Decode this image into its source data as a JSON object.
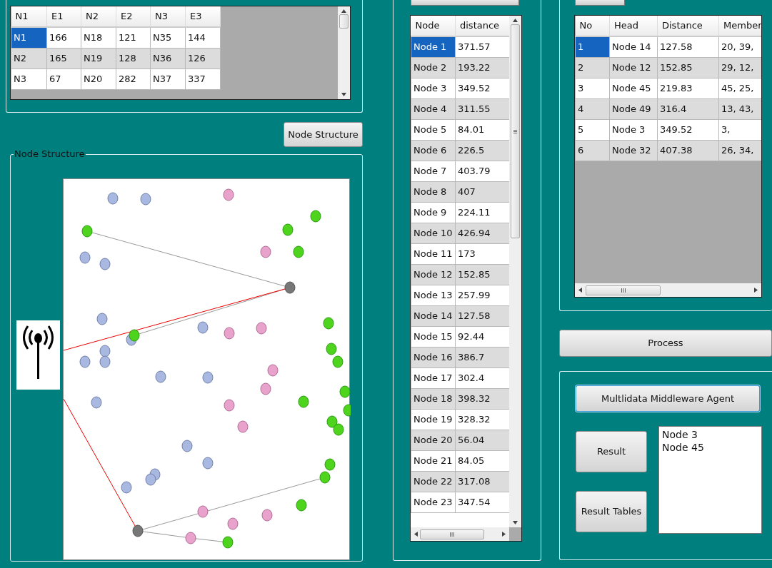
{
  "node_table": {
    "columns": [
      "N1",
      "E1",
      "N2",
      "E2",
      "N3",
      "E3"
    ],
    "rows": [
      {
        "cells": [
          "N1",
          "166",
          "N18",
          "121",
          "N35",
          "144"
        ],
        "selected": true
      },
      {
        "cells": [
          "N2",
          "165",
          "N19",
          "128",
          "N36",
          "126"
        ],
        "selected": false
      },
      {
        "cells": [
          "N3",
          "67",
          "N20",
          "282",
          "N37",
          "337"
        ],
        "selected": false
      }
    ]
  },
  "node_structure_button": "Node Structure",
  "node_structure_group": {
    "title": "Node Structure"
  },
  "distance_table": {
    "columns": [
      "Node",
      "distance"
    ],
    "rows": [
      {
        "cells": [
          "Node 1",
          "371.57"
        ],
        "selected": true
      },
      {
        "cells": [
          "Node 2",
          "193.22"
        ],
        "selected": false
      },
      {
        "cells": [
          "Node 3",
          "349.52"
        ],
        "selected": false
      },
      {
        "cells": [
          "Node 4",
          "311.55"
        ],
        "selected": false
      },
      {
        "cells": [
          "Node 5",
          "84.01"
        ],
        "selected": false
      },
      {
        "cells": [
          "Node 6",
          "226.5"
        ],
        "selected": false
      },
      {
        "cells": [
          "Node 7",
          "403.79"
        ],
        "selected": false
      },
      {
        "cells": [
          "Node 8",
          "407"
        ],
        "selected": false
      },
      {
        "cells": [
          "Node 9",
          "224.11"
        ],
        "selected": false
      },
      {
        "cells": [
          "Node 10",
          "426.94"
        ],
        "selected": false
      },
      {
        "cells": [
          "Node 11",
          "173"
        ],
        "selected": false
      },
      {
        "cells": [
          "Node 12",
          "152.85"
        ],
        "selected": false
      },
      {
        "cells": [
          "Node 13",
          "257.99"
        ],
        "selected": false
      },
      {
        "cells": [
          "Node 14",
          "127.58"
        ],
        "selected": false
      },
      {
        "cells": [
          "Node 15",
          "92.44"
        ],
        "selected": false
      },
      {
        "cells": [
          "Node 16",
          "386.7"
        ],
        "selected": false
      },
      {
        "cells": [
          "Node 17",
          "302.4"
        ],
        "selected": false
      },
      {
        "cells": [
          "Node 18",
          "398.32"
        ],
        "selected": false
      },
      {
        "cells": [
          "Node 19",
          "328.32"
        ],
        "selected": false
      },
      {
        "cells": [
          "Node 20",
          "56.04"
        ],
        "selected": false
      },
      {
        "cells": [
          "Node 21",
          "84.05"
        ],
        "selected": false
      },
      {
        "cells": [
          "Node 22",
          "317.08"
        ],
        "selected": false
      },
      {
        "cells": [
          "Node 23",
          "347.54"
        ],
        "selected": false
      }
    ]
  },
  "cluster_table": {
    "columns": [
      "No",
      "Head",
      "Distance",
      "Member"
    ],
    "rows": [
      {
        "cells": [
          "1",
          "Node 14",
          "127.58",
          "20, 39,"
        ],
        "selected": true
      },
      {
        "cells": [
          "2",
          "Node 12",
          "152.85",
          "29, 12,"
        ],
        "selected": false
      },
      {
        "cells": [
          "3",
          "Node 45",
          "219.83",
          "45, 25,"
        ],
        "selected": false
      },
      {
        "cells": [
          "4",
          "Node 49",
          "316.4",
          "13, 43,"
        ],
        "selected": false
      },
      {
        "cells": [
          "5",
          "Node 3",
          "349.52",
          "3,"
        ],
        "selected": false
      },
      {
        "cells": [
          "6",
          "Node 32",
          "407.38",
          "26, 34,"
        ],
        "selected": false
      }
    ]
  },
  "process_button": "Process",
  "agent_button": "Multlidata Middleware Agent",
  "result_button": "Result",
  "result_tables_button": "Result Tables",
  "result_list": [
    "Node 3",
    "Node 45"
  ]
}
